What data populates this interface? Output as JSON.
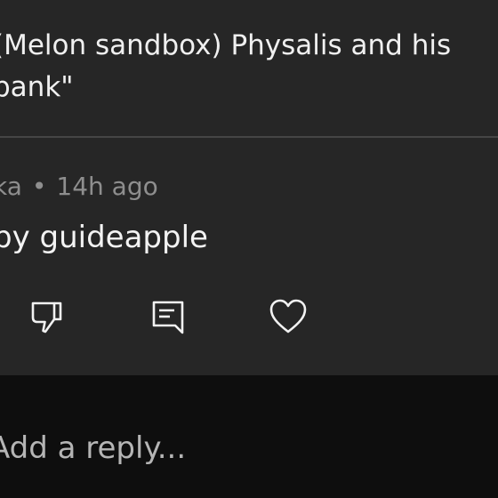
{
  "parent_comment": {
    "text": "(Melon sandbox) Physalis and his\nbank\""
  },
  "comment": {
    "author": "ka",
    "separator": "•",
    "time": "14h ago",
    "text": "py guideapple"
  },
  "actions": {
    "dislike_icon": "thumbs-down-icon",
    "reply_icon": "comment-icon",
    "like_icon": "heart-icon"
  },
  "reply_bar": {
    "placeholder": "Add a reply..."
  },
  "colors": {
    "card_background": "#262626",
    "page_background": "#0e0e0e",
    "muted_text": "#8e8e8e",
    "divider": "#454545"
  }
}
